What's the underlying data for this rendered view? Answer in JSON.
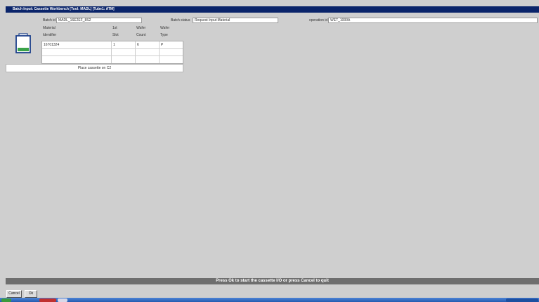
{
  "window": {
    "title": "Batch Input: Cassette Workbench [Tool: MADL] [Tube1: ATM]"
  },
  "batch": {
    "id_label": "Batch id",
    "id_value": "MADL_16E2EF_8S2",
    "status_label": "Batch status",
    "status_value": "Request Input Material",
    "operation_label": "operation id",
    "operation_value": "WET_1000A"
  },
  "table": {
    "headers": [
      [
        "Material",
        "Identifier"
      ],
      [
        "1st",
        "Slot"
      ],
      [
        "Wafer",
        "Count"
      ],
      [
        "Wafer",
        "Type"
      ]
    ],
    "rows": [
      [
        "16701324",
        "1",
        "6",
        "P"
      ]
    ]
  },
  "placement": {
    "instruction": "Place cassette on C2"
  },
  "status": {
    "message": "Press Ok to start the cassette I/O or press Cancel to quit"
  },
  "buttons": {
    "cancel": "Cancel",
    "ok": "Ok"
  },
  "colors": {
    "title_bar": "#0a246a",
    "status_bar": "#6e6e6e",
    "background": "#cfcfcf",
    "cassette_fill": "#3aa34a"
  },
  "icons": {
    "cassette": "cassette-icon"
  }
}
